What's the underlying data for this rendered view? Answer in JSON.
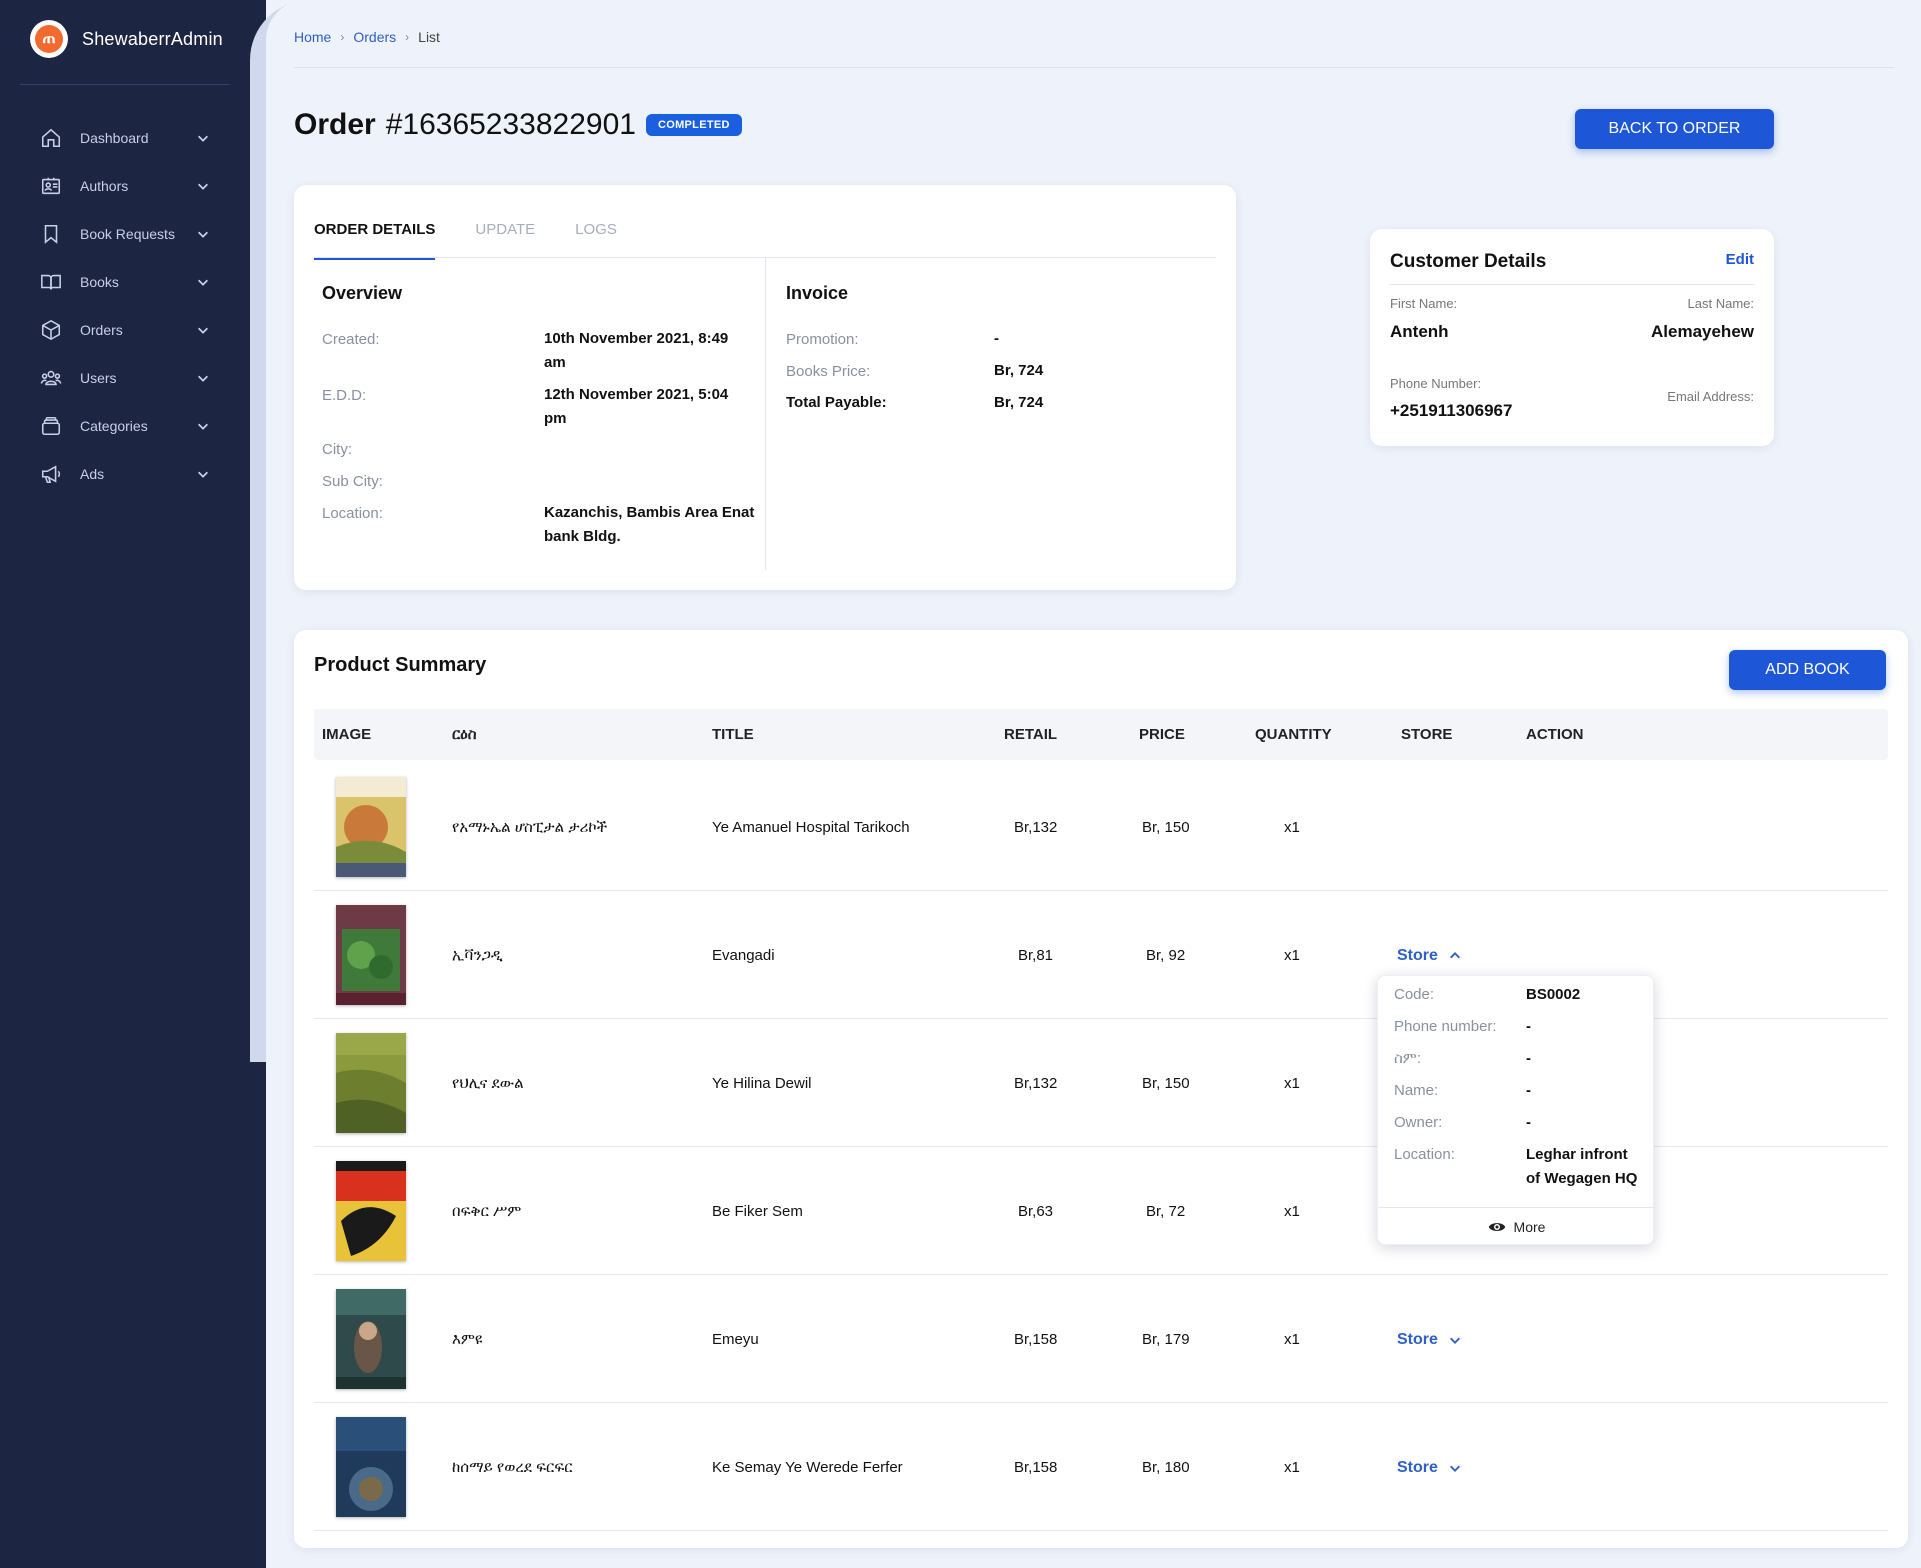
{
  "brand": {
    "name": "ShewaberrAdmin",
    "logo_letter": "ጠ"
  },
  "sidebar": {
    "items": [
      {
        "label": "Dashboard",
        "icon": "home-icon"
      },
      {
        "label": "Authors",
        "icon": "id-card-icon"
      },
      {
        "label": "Book Requests",
        "icon": "bookmark-icon"
      },
      {
        "label": "Books",
        "icon": "open-book-icon"
      },
      {
        "label": "Orders",
        "icon": "box-icon"
      },
      {
        "label": "Users",
        "icon": "users-icon"
      },
      {
        "label": "Categories",
        "icon": "layers-icon"
      },
      {
        "label": "Ads",
        "icon": "megaphone-icon"
      }
    ]
  },
  "breadcrumb": {
    "home": "Home",
    "orders": "Orders",
    "current": "List"
  },
  "order": {
    "title": "Order",
    "number": "#16365233822901",
    "status": "COMPLETED",
    "back_label": "BACK TO ORDER"
  },
  "tabs": [
    "ORDER DETAILS",
    "UPDATE",
    "LOGS"
  ],
  "overview": {
    "title": "Overview",
    "created_label": "Created:",
    "created_val_1": "10th November 2021, 8:49",
    "created_val_2": "am",
    "edd_label": "E.D.D:",
    "edd_val_1": "12th November 2021, 5:04",
    "edd_val_2": "pm",
    "city_label": "City:",
    "subcity_label": "Sub City:",
    "location_label": "Location:",
    "location_val_1": "Kazanchis, Bambis Area Enat",
    "location_val_2": "bank Bldg."
  },
  "invoice": {
    "title": "Invoice",
    "promotion_label": "Promotion:",
    "promotion_val": "-",
    "books_price_label": "Books Price:",
    "books_price_val": "Br, 724",
    "total_label": "Total Payable:",
    "total_val": "Br, 724"
  },
  "customer": {
    "title": "Customer Details",
    "edit": "Edit",
    "first_name_label": "First Name:",
    "first_name": "Antenh",
    "last_name_label": "Last Name:",
    "last_name": "Alemayehew",
    "phone_label": "Phone Number:",
    "phone": "+251911306967",
    "email_label": "Email Address:"
  },
  "products": {
    "title": "Product Summary",
    "add_label": "ADD BOOK",
    "columns": [
      "IMAGE",
      "ርዕስ",
      "TITLE",
      "RETAIL",
      "PRICE",
      "QUANTITY",
      "STORE",
      "ACTION"
    ],
    "rows": [
      {
        "amharic": "የአማኑኤል ሆስፒታል ታሪኮች",
        "title": "Ye Amanuel Hospital Tarikoch",
        "retail": "Br,132",
        "price": "Br, 150",
        "qty": "x1",
        "store": ""
      },
      {
        "amharic": "ኢቫንጋዲ",
        "title": "Evangadi",
        "retail": "Br,81",
        "price": "Br, 92",
        "qty": "x1",
        "store": "Store"
      },
      {
        "amharic": "የህሊና ደውል",
        "title": "Ye Hilina Dewil",
        "retail": "Br,132",
        "price": "Br, 150",
        "qty": "x1",
        "store": ""
      },
      {
        "amharic": "በፍቅር ሥም",
        "title": "Be Fiker Sem",
        "retail": "Br,63",
        "price": "Br, 72",
        "qty": "x1",
        "store": ""
      },
      {
        "amharic": "እምዩ",
        "title": "Emeyu",
        "retail": "Br,158",
        "price": "Br, 179",
        "qty": "x1",
        "store": "Store"
      },
      {
        "amharic": "ከሰማይ የወረደ ፍርፍር",
        "title": "Ke Semay Ye Werede Ferfer",
        "retail": "Br,158",
        "price": "Br, 180",
        "qty": "x1",
        "store": "Store"
      }
    ]
  },
  "store_popover": {
    "code_label": "Code:",
    "code": "BS0002",
    "phone_label": "Phone number:",
    "phone": "-",
    "sim_label": "ስም:",
    "sim": "-",
    "name_label": "Name:",
    "name": "-",
    "owner_label": "Owner:",
    "owner": "-",
    "location_label": "Location:",
    "location_1": "Leghar infront",
    "location_2": "of Wegagen HQ",
    "more": "More"
  },
  "colors": {
    "sidebar": "#1c2541",
    "primary": "#1d56d6",
    "link": "#2f5fc4",
    "brand_logo": "#f26a2e"
  }
}
